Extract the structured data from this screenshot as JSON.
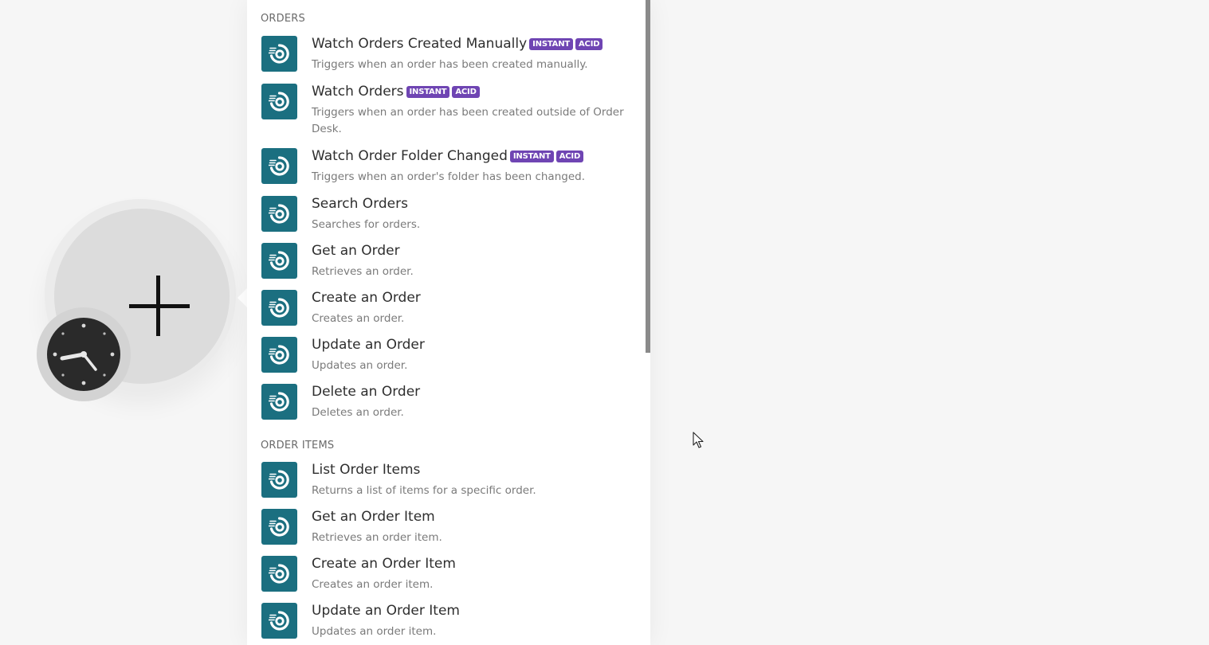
{
  "sections": [
    {
      "title": "ORDERS",
      "items": [
        {
          "title": "Watch Orders Created Manually",
          "badges": [
            "INSTANT",
            "ACID"
          ],
          "desc": "Triggers when an order has been created manually."
        },
        {
          "title": "Watch Orders",
          "badges": [
            "INSTANT",
            "ACID"
          ],
          "desc": "Triggers when an order has been created outside of Order Desk."
        },
        {
          "title": "Watch Order Folder Changed",
          "badges": [
            "INSTANT",
            "ACID"
          ],
          "desc": "Triggers when an order's folder has been changed."
        },
        {
          "title": "Search Orders",
          "badges": [],
          "desc": "Searches for orders."
        },
        {
          "title": "Get an Order",
          "badges": [],
          "desc": "Retrieves an order."
        },
        {
          "title": "Create an Order",
          "badges": [],
          "desc": "Creates an order."
        },
        {
          "title": "Update an Order",
          "badges": [],
          "desc": "Updates an order."
        },
        {
          "title": "Delete an Order",
          "badges": [],
          "desc": "Deletes an order."
        }
      ]
    },
    {
      "title": "ORDER ITEMS",
      "items": [
        {
          "title": "List Order Items",
          "badges": [],
          "desc": "Returns a list of items for a specific order."
        },
        {
          "title": "Get an Order Item",
          "badges": [],
          "desc": "Retrieves an order item."
        },
        {
          "title": "Create an Order Item",
          "badges": [],
          "desc": "Creates an order item."
        },
        {
          "title": "Update an Order Item",
          "badges": [],
          "desc": "Updates an order item."
        }
      ]
    }
  ],
  "colors": {
    "app_icon_bg": "#1b6f80",
    "badge_bg": "#6f45b3",
    "panel_bg": "#ffffff",
    "canvas_bg": "#f6f6f6"
  },
  "icons": {
    "module": "plus-icon",
    "trigger": "clock-icon",
    "app": "order-desk-icon"
  }
}
